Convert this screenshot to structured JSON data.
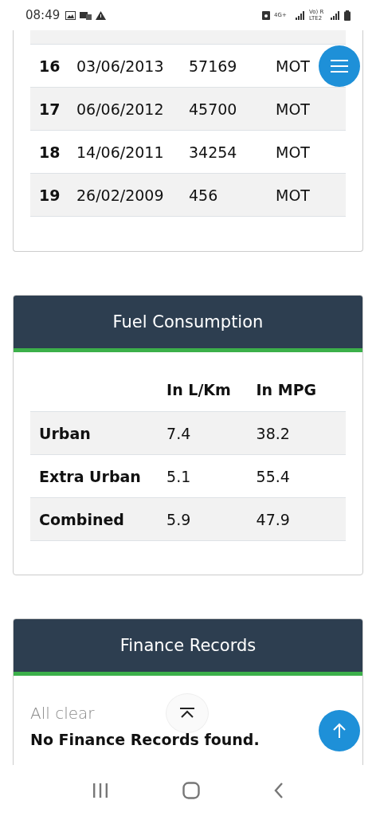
{
  "status_bar": {
    "time": "08:49",
    "network_label": "4G+",
    "carrier_label": "Vo) R LTE2"
  },
  "service_history": {
    "rows": [
      {
        "number": "16",
        "date": "03/06/2013",
        "mileage": "57169",
        "type": "MOT"
      },
      {
        "number": "17",
        "date": "06/06/2012",
        "mileage": "45700",
        "type": "MOT"
      },
      {
        "number": "18",
        "date": "14/06/2011",
        "mileage": "34254",
        "type": "MOT"
      },
      {
        "number": "19",
        "date": "26/02/2009",
        "mileage": "456",
        "type": "MOT"
      }
    ]
  },
  "fuel_consumption": {
    "title": "Fuel Consumption",
    "columns": [
      "In L/Km",
      "In MPG"
    ],
    "rows": [
      {
        "label": "Urban",
        "l_km": "7.4",
        "mpg": "38.2"
      },
      {
        "label": "Extra Urban",
        "l_km": "5.1",
        "mpg": "55.4"
      },
      {
        "label": "Combined",
        "l_km": "5.9",
        "mpg": "47.9"
      }
    ]
  },
  "finance_records": {
    "title": "Finance Records",
    "status": "All clear",
    "message": "No Finance Records found."
  }
}
